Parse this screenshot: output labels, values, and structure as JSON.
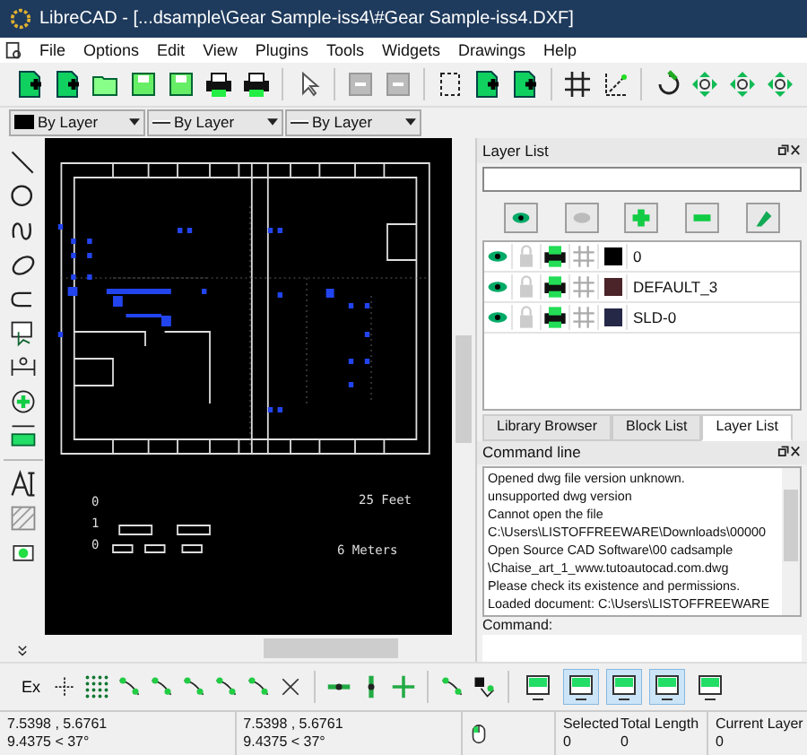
{
  "window": {
    "title": "LibreCAD - [...dsample\\Gear Sample-iss4\\#Gear Sample-iss4.DXF]"
  },
  "menu": [
    "File",
    "Options",
    "Edit",
    "View",
    "Plugins",
    "Tools",
    "Widgets",
    "Drawings",
    "Help"
  ],
  "pen_toolbar": [
    {
      "kind": "color",
      "value": "By Layer"
    },
    {
      "kind": "width",
      "value": "By Layer"
    },
    {
      "kind": "linetype",
      "value": "By Layer"
    }
  ],
  "drawing": {
    "scale_labels": [
      "25 Feet",
      "6 Meters"
    ],
    "ruler_marks": [
      "0",
      "1",
      "0"
    ]
  },
  "layer_panel": {
    "title": "Layer List",
    "layers": [
      {
        "name": "0",
        "color": "#000000"
      },
      {
        "name": "DEFAULT_3",
        "color": "#4a2428"
      },
      {
        "name": "SLD-0",
        "color": "#262848"
      }
    ],
    "tabs": [
      {
        "label": "Library Browser",
        "selected": false
      },
      {
        "label": "Block List",
        "selected": false
      },
      {
        "label": "Layer List",
        "selected": true
      }
    ]
  },
  "command_panel": {
    "title": "Command line",
    "log": [
      "Opened dwg file version unknown.",
      "unsupported dwg version",
      "Cannot open the file",
      "C:\\Users\\LISTOFFREEWARE\\Downloads\\00000",
      "Open Source CAD Software\\00 cadsample",
      "\\Chaise_art_1_www.tutoautocad.com.dwg",
      "Please check its existence and permissions.",
      "Loaded document: C:\\Users\\LISTOFFREEWARE"
    ],
    "input_label": "Command:"
  },
  "snap_toolbar": {
    "exclusive_label": "Ex",
    "views": [
      {
        "selected": false
      },
      {
        "selected": true
      },
      {
        "selected": true
      },
      {
        "selected": true
      },
      {
        "selected": false
      }
    ]
  },
  "status_bar": {
    "abs_coords": [
      "7.5398 , 5.6761",
      "9.4375 < 37°"
    ],
    "rel_coords": [
      "7.5398 , 5.6761",
      "9.4375 < 37°"
    ],
    "selected_label": "Selected",
    "selected_value": "0",
    "length_label": "Total Length",
    "length_value": "0",
    "layer_label": "Current Layer",
    "layer_value": "0"
  }
}
